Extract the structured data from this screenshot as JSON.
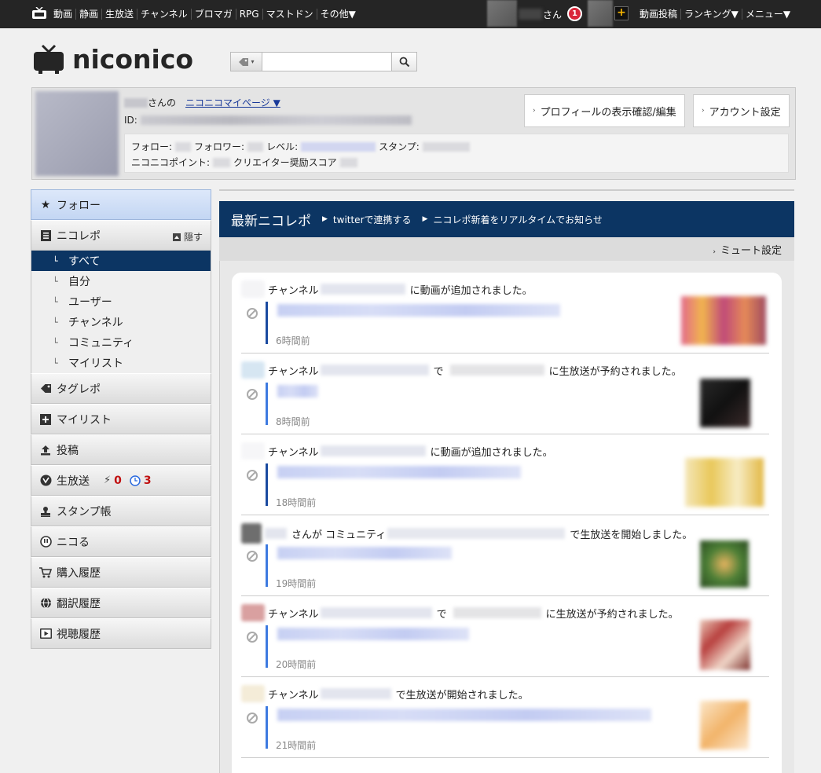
{
  "topbar": {
    "nav": [
      "動画",
      "静画",
      "生放送",
      "チャンネル",
      "ブロマガ",
      "RPG",
      "マストドン",
      "その他▼"
    ],
    "user_suffix": "さん",
    "notification_count": "1",
    "plus_label": "+",
    "right_nav": [
      "動画投稿",
      "ランキング▼",
      "メニュー▼"
    ]
  },
  "logo": {
    "text": "niconico"
  },
  "search": {
    "value": "",
    "placeholder": ""
  },
  "profile": {
    "owner_suffix": "さんの",
    "mypage_link": "ニコニコマイページ ▼",
    "id_label": "ID:",
    "profile_button": "プロフィールの表示確認/編集",
    "account_button": "アカウント設定",
    "follow_label": "フォロー:",
    "follower_label": "フォロワー:",
    "level_label": "レベル:",
    "stamp_label": "スタンプ:",
    "points_label": "ニコニコポイント:",
    "creator_label": "クリエイター奨励スコア"
  },
  "sidebar": {
    "follow": "フォロー",
    "nicorepo": "ニコレポ",
    "hide": "隠す",
    "sub_items": [
      "すべて",
      "自分",
      "ユーザー",
      "チャンネル",
      "コミュニティ",
      "マイリスト"
    ],
    "tagrepo": "タグレポ",
    "mylist": "マイリスト",
    "post": "投稿",
    "live": "生放送",
    "live_onair_count": "0",
    "live_reserved_count": "3",
    "stamp_book": "スタンプ帳",
    "nicoru": "ニコる",
    "purchase_history": "購入履歴",
    "translation_history": "翻訳履歴",
    "watch_history": "視聴履歴"
  },
  "main": {
    "title": "最新ニコレポ",
    "twitter_link": "twitterで連携する",
    "realtime_link": "ニコレポ新着をリアルタイムでお知らせ",
    "mute_setting": "ミュート設定"
  },
  "feed": [
    {
      "kind": "チャンネル",
      "middle": "",
      "action": "に動画が追加されました。",
      "time": "6時間前"
    },
    {
      "kind": "チャンネル",
      "middle": "で",
      "action": "に生放送が予約されました。",
      "time": "8時間前"
    },
    {
      "kind": "チャンネル",
      "middle": "",
      "action": "に動画が追加されました。",
      "time": "18時間前"
    },
    {
      "kind": "さんが コミュニティ",
      "middle": "",
      "action": "で生放送を開始しました。",
      "time": "19時間前"
    },
    {
      "kind": "チャンネル",
      "middle": "で",
      "action": "に生放送が予約されました。",
      "time": "20時間前"
    },
    {
      "kind": "チャンネル",
      "middle": "",
      "action": "で生放送が開始されました。",
      "time": "21時間前"
    }
  ],
  "colors": {
    "topbar": "#252525",
    "header_navy": "#0c3563",
    "badge_red": "#d9263a",
    "count_red": "#c01010",
    "count_blue": "#2255cc",
    "video_bar": "#1a4aa0",
    "live_bar": "#3d7ae0"
  }
}
